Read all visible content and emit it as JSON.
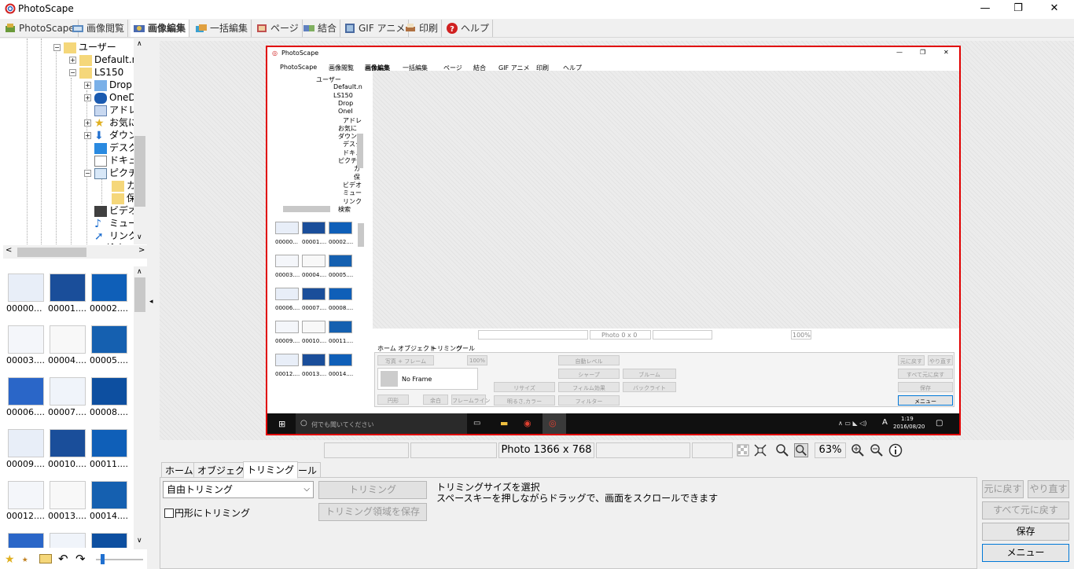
{
  "window": {
    "title": "PhotoScape",
    "minimize": "—",
    "maximize": "❐",
    "close": "✕"
  },
  "menu_tabs": [
    {
      "label": "PhotoScape",
      "active": false
    },
    {
      "label": "画像閲覧",
      "active": false
    },
    {
      "label": "画像編集",
      "active": true
    },
    {
      "label": "一括編集",
      "active": false
    },
    {
      "label": "ページ",
      "active": false
    },
    {
      "label": "結合",
      "active": false
    },
    {
      "label": "GIF アニメ",
      "active": false
    },
    {
      "label": "印刷",
      "active": false
    },
    {
      "label": "ヘルプ",
      "active": false
    }
  ],
  "tree": [
    {
      "label": "ユーザー",
      "expander": "−"
    },
    {
      "label": "Default.m",
      "expander": "+"
    },
    {
      "label": "LS150",
      "expander": "−"
    },
    {
      "label": "Drop",
      "expander": "+"
    },
    {
      "label": "OneD",
      "expander": "+"
    },
    {
      "label": "アドレ",
      "expander": ""
    },
    {
      "label": "お気に",
      "expander": "+"
    },
    {
      "label": "ダウン",
      "expander": "+"
    },
    {
      "label": "デスク",
      "expander": ""
    },
    {
      "label": "ドキュ",
      "expander": ""
    },
    {
      "label": "ピクチ",
      "expander": "−"
    },
    {
      "label": "カ",
      "expander": ""
    },
    {
      "label": "保",
      "expander": ""
    },
    {
      "label": "ビデオ",
      "expander": ""
    },
    {
      "label": "ミュー",
      "expander": ""
    },
    {
      "label": "リンク",
      "expander": ""
    },
    {
      "label": "検索",
      "expander": "+"
    }
  ],
  "thumbnails": [
    "00000...",
    "00001....",
    "00002....",
    "00003....",
    "00004....",
    "00005....",
    "00006....",
    "00007....",
    "00008....",
    "00009....",
    "00010....",
    "00011....",
    "00012....",
    "00013....",
    "00014....",
    "",
    "",
    ""
  ],
  "status": {
    "photo_size": "Photo 1366 x 768",
    "zoom": "63%"
  },
  "bottom_tabs": [
    {
      "label": "ホーム",
      "active": false
    },
    {
      "label": "オブジェクト",
      "active": false
    },
    {
      "label": "トリミング",
      "active": true
    },
    {
      "label": "ツール",
      "active": false
    }
  ],
  "trim": {
    "mode_value": "自由トリミング",
    "trim_button": "トリミング",
    "save_area_button": "トリミング領域を保存",
    "circle_checkbox": "円形にトリミング",
    "help_line1": "トリミングサイズを選択",
    "help_line2": "スペースキーを押しながらドラッグで、画面をスクロールできます"
  },
  "actions": {
    "undo": "元に戻す",
    "redo": "やり直す",
    "undo_all": "すべて元に戻す",
    "save": "保存",
    "menu": "メニュー"
  },
  "preview": {
    "title": "PhotoScape",
    "menu_tabs": [
      "PhotoScape",
      "画像閲覧",
      "画像編集",
      "一括編集",
      "ページ",
      "結合",
      "GIF アニメ",
      "印刷",
      "ヘルプ"
    ],
    "tree": [
      "ユーザー",
      "Default.n",
      "LS150",
      "Drop",
      "OneI",
      "アドレ",
      "お気に",
      "ダウン",
      "デスク",
      "ドキュ",
      "ピクチ",
      "カ",
      "保",
      "ビデオ",
      "ミュー",
      "リンク",
      "検索"
    ],
    "thumbs": [
      "00000...",
      "00001....",
      "00002....",
      "00003....",
      "00004....",
      "00005....",
      "00006....",
      "00007....",
      "00008....",
      "00009....",
      "00010....",
      "00011....",
      "00012....",
      "00013....",
      "00014...."
    ],
    "status_photo": "Photo 0 x 0",
    "zoom": "100%",
    "tabs": [
      "ホーム",
      "オブジェクト",
      "トリミング",
      "ツール"
    ],
    "buttons": {
      "photo_frame": "写真 + フレーム",
      "size_pct": "100%",
      "frame_select": "No Frame",
      "round": "円形",
      "margin": "余白",
      "frameline": "フレームライン",
      "auto_level": "自動レベル",
      "sharpen": "シャープ",
      "bloom": "ブルーム",
      "resize": "リサイズ",
      "film_effect": "フィルム効果",
      "backlight": "バックライト",
      "bright_color": "明るさ,カラー",
      "filter": "フィルター",
      "undo": "元に戻す",
      "redo": "やり直す",
      "undo_all": "すべて元に戻す",
      "save": "保存",
      "menu": "メニュー"
    },
    "taskbar": {
      "search": "何でも聞いてください",
      "time": "1:19",
      "date": "2016/08/20",
      "ime": "A"
    }
  },
  "colors": {
    "selection_border": "#e00000",
    "accent": "#0078d7"
  }
}
